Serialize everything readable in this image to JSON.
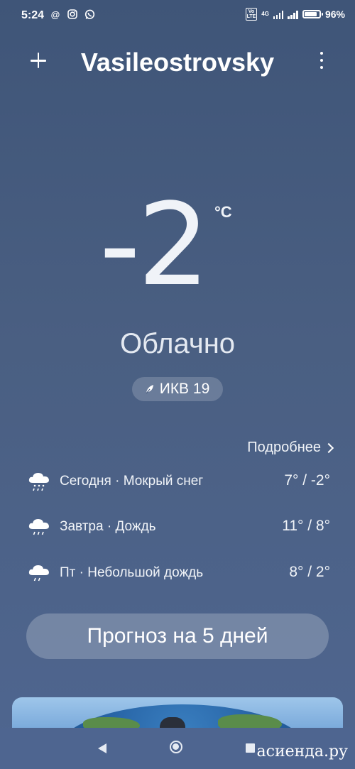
{
  "status_bar": {
    "time": "5:24",
    "left_icons": [
      "at-sign-icon",
      "instagram-icon",
      "whatsapp-icon"
    ],
    "volte": "Vo LTE",
    "network": "4G",
    "battery_percent": "96%",
    "battery_level": 0.96
  },
  "header": {
    "city": "Vasileostrovsky"
  },
  "current": {
    "temperature": "-2",
    "unit": "°C",
    "condition": "Облачно",
    "aqi_label": "ИКВ 19"
  },
  "details_link": "Подробнее",
  "forecast": [
    {
      "icon": "sleet-icon",
      "text": "Сегодня · Мокрый снег",
      "temps": "7° / -2°"
    },
    {
      "icon": "rain-icon",
      "text": "Завтра · Дождь",
      "temps": "11° / 8°"
    },
    {
      "icon": "light-rain-icon",
      "text": "Пт · Небольшой дождь",
      "temps": "8° / 2°"
    }
  ],
  "forecast_button": "Прогноз на 5 дней",
  "watermark": "асиенда.ру",
  "colors": {
    "background_top": "#3f5578",
    "background_bottom": "#4f6690",
    "text": "#ffffff"
  }
}
